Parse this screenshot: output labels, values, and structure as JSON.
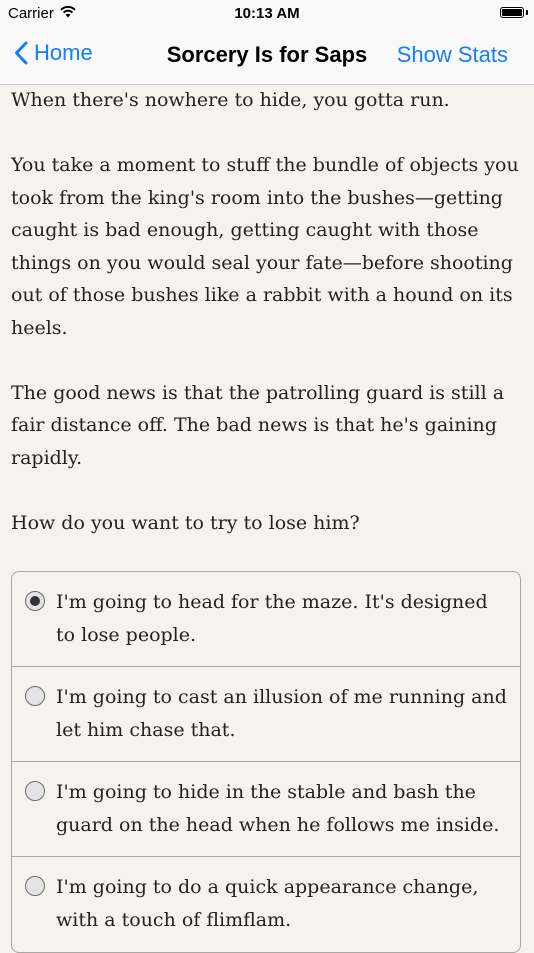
{
  "status_bar": {
    "carrier": "Carrier",
    "time": "10:13 AM",
    "icons": [
      "wifi-icon",
      "battery-icon"
    ]
  },
  "nav": {
    "back_label": "Home",
    "title": "Sorcery Is for Saps",
    "right_label": "Show Stats",
    "accent_color": "#147efb"
  },
  "story": {
    "paragraphs": [
      "When there's nowhere to hide, you gotta run.",
      "You take a moment to stuff the bundle of objects you took from the king's room into the bushes—getting caught is bad enough, getting caught with those things on you would seal your fate—before shooting out of those bushes like a rabbit with a hound on its heels.",
      "The good news is that the patrolling guard is still a fair distance off. The bad news is that he's gaining rapidly.",
      "How do you want to try to lose him?"
    ]
  },
  "choices": [
    {
      "text": "I'm going to head for the maze. It's designed to lose people.",
      "selected": true
    },
    {
      "text": "I'm going to cast an illusion of me running and let him chase that.",
      "selected": false
    },
    {
      "text": "I'm going to hide in the stable and bash the guard on the head when he follows me inside.",
      "selected": false
    },
    {
      "text": "I'm going to do a quick appearance change, with a touch of flimflam.",
      "selected": false
    }
  ]
}
